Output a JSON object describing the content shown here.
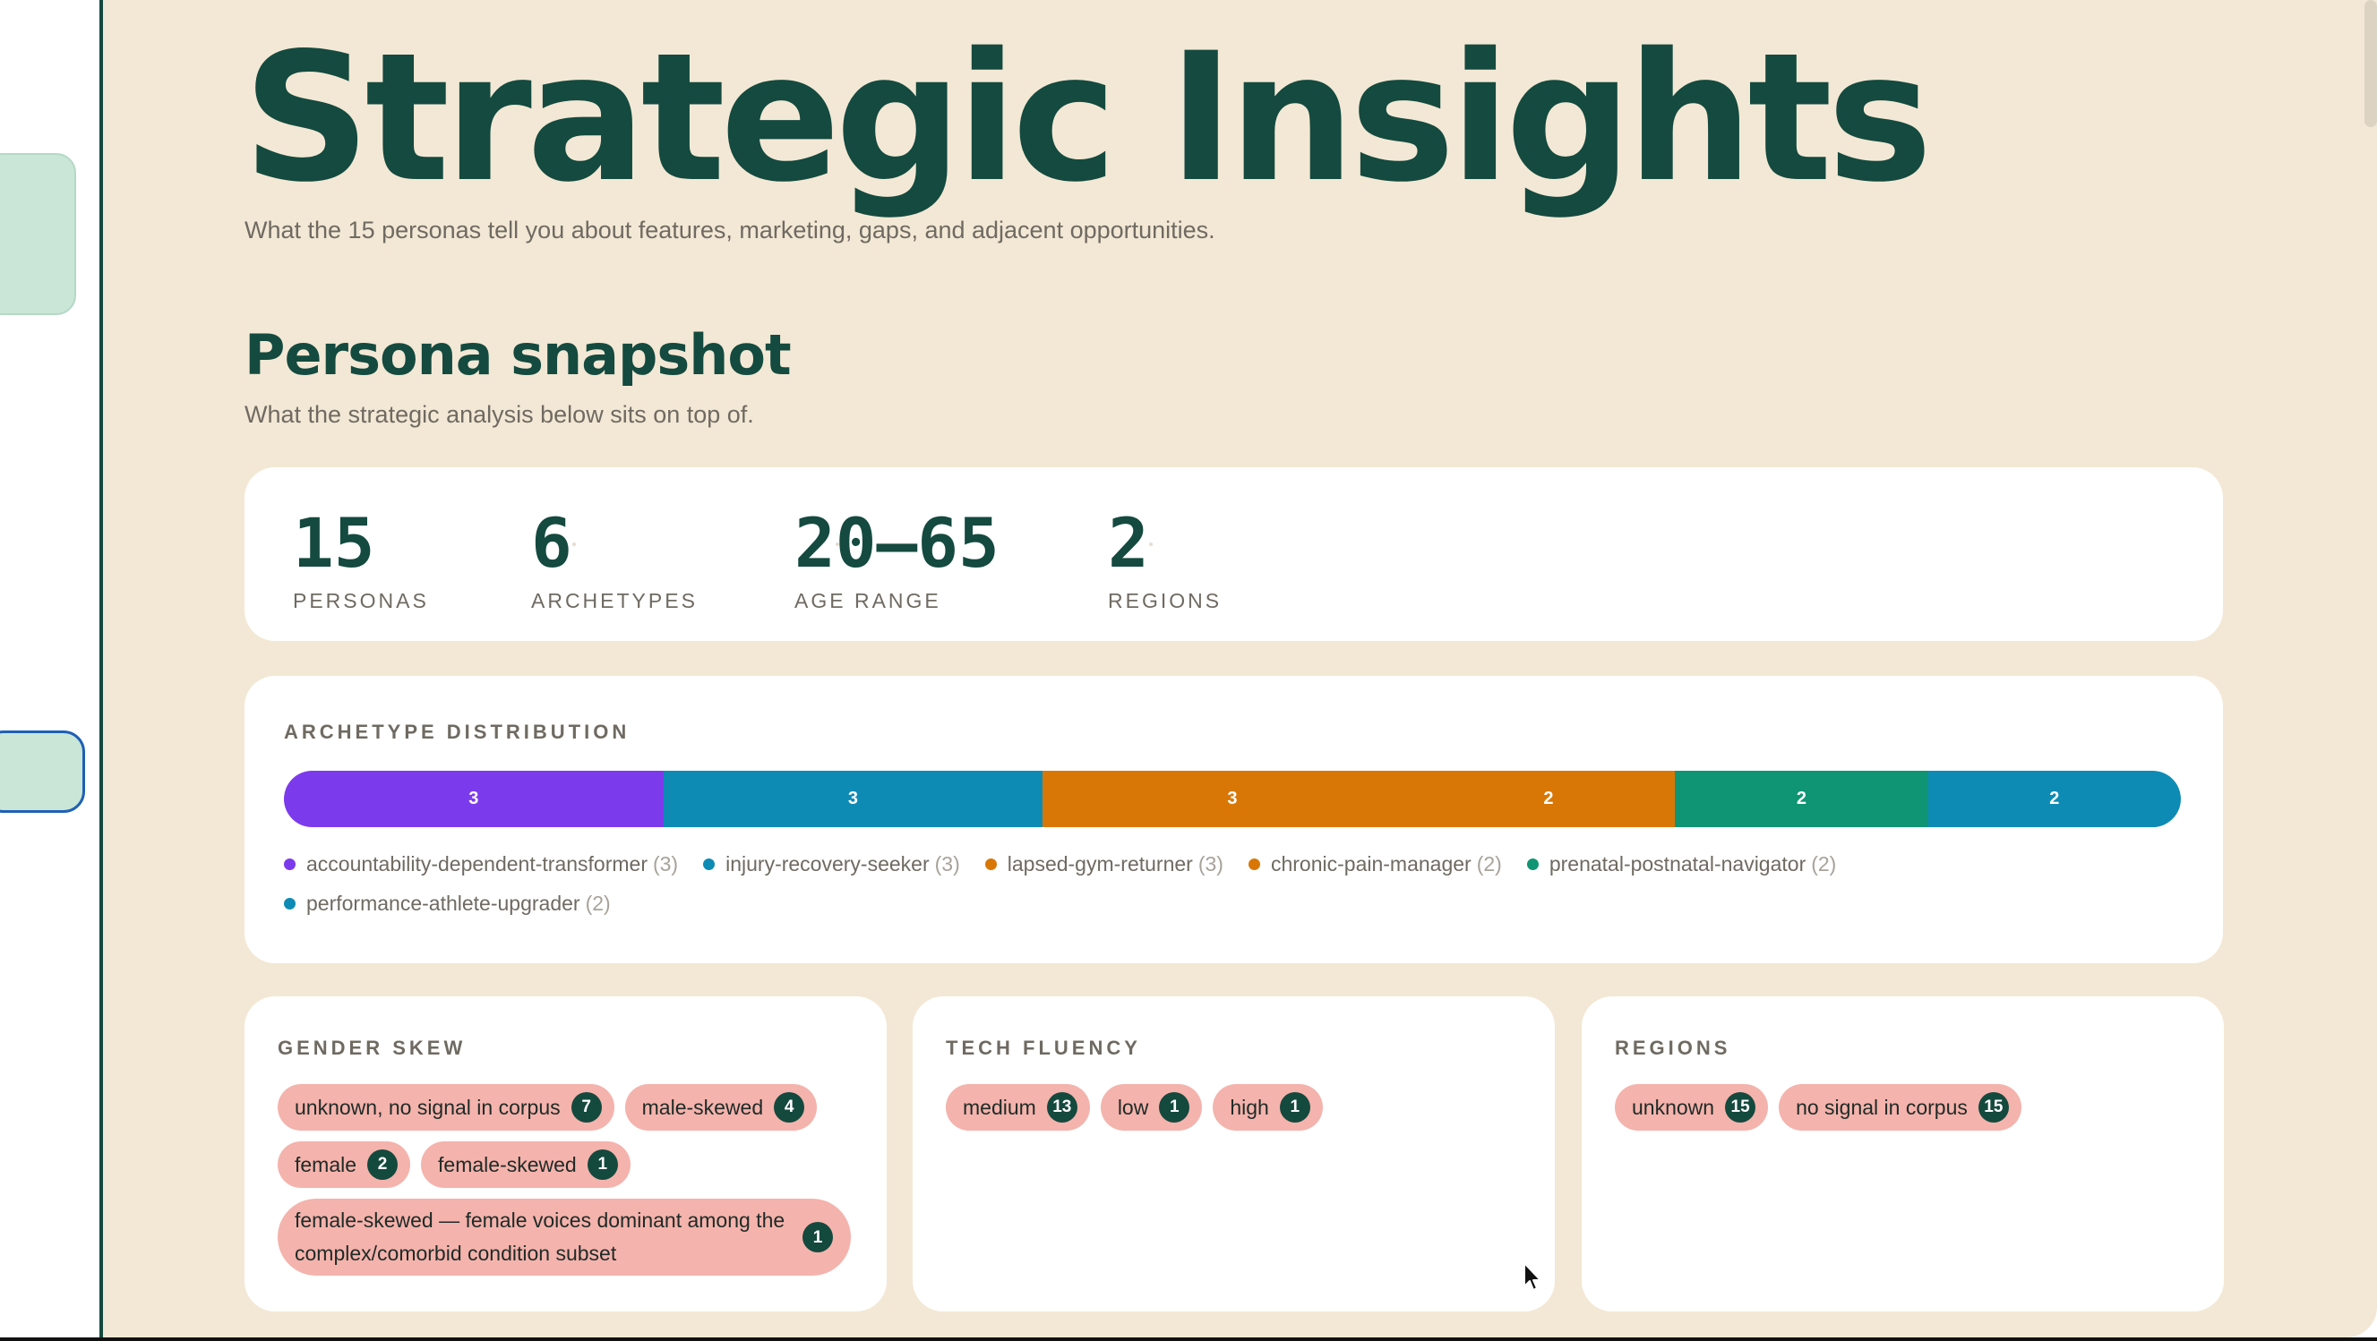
{
  "header": {
    "title": "Strategic Insights",
    "subtitle": "What the 15 personas tell you about features, marketing, gaps, and adjacent opportunities."
  },
  "snapshot": {
    "title": "Persona snapshot",
    "subtitle": "What the strategic analysis below sits on top of.",
    "stats": [
      {
        "value": "15",
        "label": "PERSONAS"
      },
      {
        "value": "6",
        "label": "ARCHETYPES"
      },
      {
        "value": "20–65",
        "label": "AGE RANGE"
      },
      {
        "value": "2",
        "label": "REGIONS"
      }
    ]
  },
  "archetype_distribution": {
    "heading": "ARCHETYPE DISTRIBUTION",
    "segments": [
      {
        "name": "accountability-dependent-transformer",
        "count": 3,
        "count_label": "(3)",
        "bar_label": "3",
        "color": "#7c3aed"
      },
      {
        "name": "injury-recovery-seeker",
        "count": 3,
        "count_label": "(3)",
        "bar_label": "3",
        "color": "#0e8bb5"
      },
      {
        "name": "lapsed-gym-returner",
        "count": 3,
        "count_label": "(3)",
        "bar_label": "3",
        "color": "#d97706"
      },
      {
        "name": "chronic-pain-manager",
        "count": 2,
        "count_label": "(2)",
        "bar_label": "2",
        "color": "#d97706"
      },
      {
        "name": "prenatal-postnatal-navigator",
        "count": 2,
        "count_label": "(2)",
        "bar_label": "2",
        "color": "#0f9573"
      },
      {
        "name": "performance-athlete-upgrader",
        "count": 2,
        "count_label": "(2)",
        "bar_label": "2",
        "color": "#0e8bb5"
      }
    ]
  },
  "gender_skew": {
    "heading": "GENDER SKEW",
    "chips": [
      {
        "label": "unknown, no signal in corpus",
        "count": "7"
      },
      {
        "label": "male-skewed",
        "count": "4"
      },
      {
        "label": "female",
        "count": "2"
      },
      {
        "label": "female-skewed",
        "count": "1"
      },
      {
        "label": "female-skewed — female voices dominant among the complex/comorbid condition subset",
        "count": "1"
      }
    ]
  },
  "tech_fluency": {
    "heading": "TECH FLUENCY",
    "chips": [
      {
        "label": "medium",
        "count": "13"
      },
      {
        "label": "low",
        "count": "1"
      },
      {
        "label": "high",
        "count": "1"
      }
    ]
  },
  "regions": {
    "heading": "REGIONS",
    "chips": [
      {
        "label": "unknown",
        "count": "15"
      },
      {
        "label": "no signal in corpus",
        "count": "15"
      }
    ]
  },
  "colors": {
    "background": "#f3e8d5",
    "card": "#ffffff",
    "accent_dark_green": "#144a3f",
    "chip_pink": "#f4b3ac"
  }
}
